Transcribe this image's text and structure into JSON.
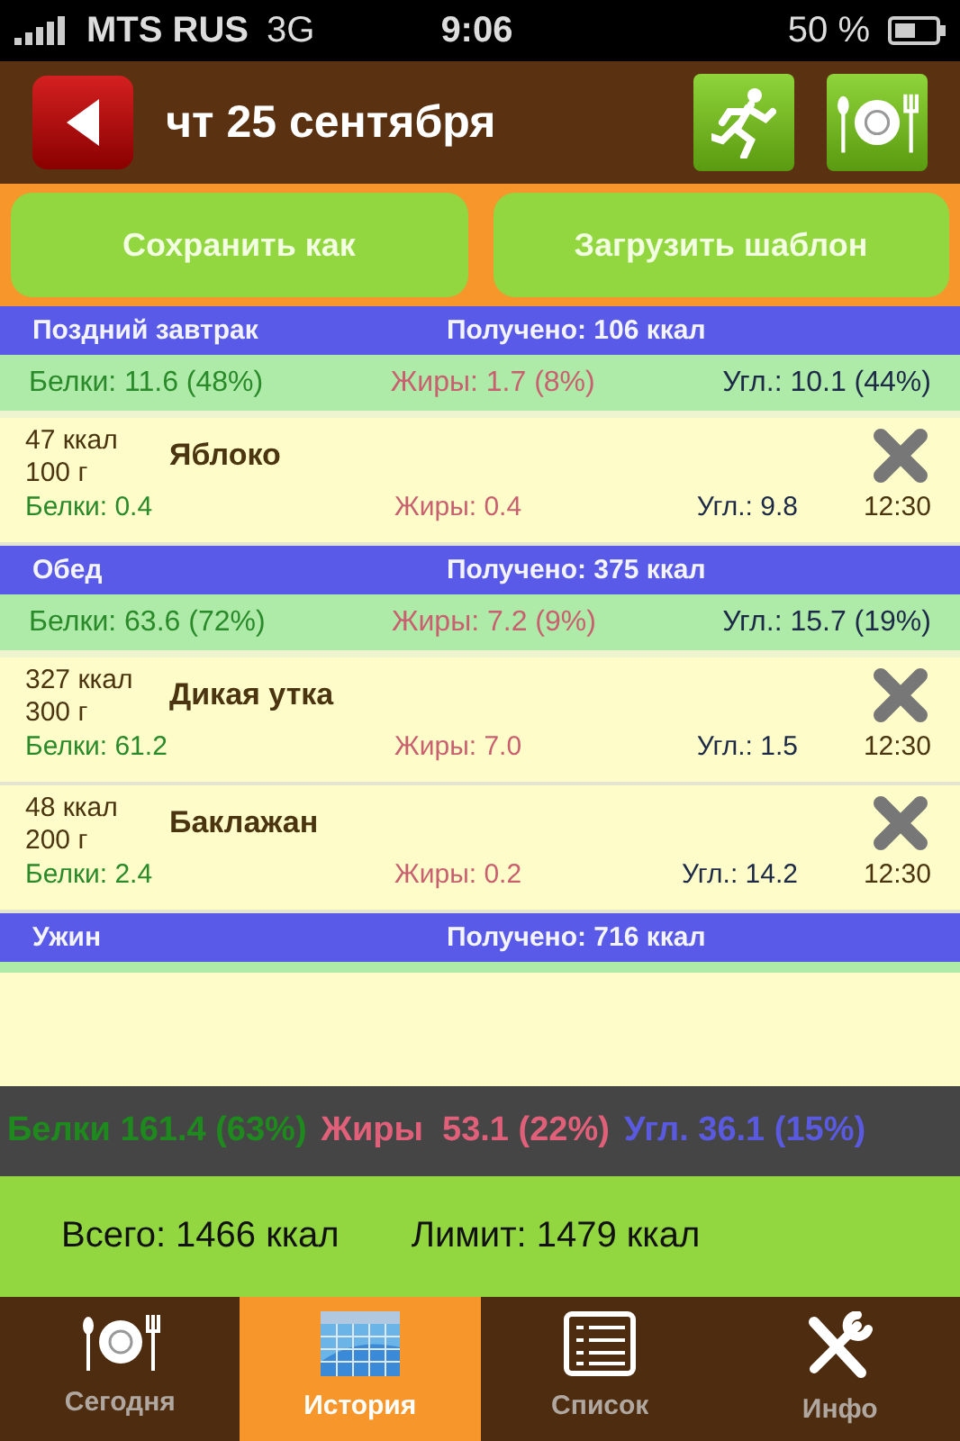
{
  "status_bar": {
    "carrier": "MTS RUS",
    "network": "3G",
    "time": "9:06",
    "battery": "50 %"
  },
  "header": {
    "date": "чт 25 сентября"
  },
  "actions": [
    "Сохранить как",
    "Загрузить шаблон"
  ],
  "meals": [
    {
      "name": "Поздний завтрак",
      "received": "Получено: 106 ккал",
      "macros": {
        "protein": "Белки: 11.6 (48%)",
        "fat": "Жиры: 1.7 (8%)",
        "carbs": "Угл.: 10.1 (44%)"
      },
      "items": [
        {
          "kcal": "47 ккал",
          "weight": "100 г",
          "name": "Яблоко",
          "protein": "Белки: 0.4",
          "fat": "Жиры: 0.4",
          "carbs": "Угл.: 9.8",
          "time": "12:30"
        }
      ]
    },
    {
      "name": "Обед",
      "received": "Получено: 375 ккал",
      "macros": {
        "protein": "Белки: 63.6 (72%)",
        "fat": "Жиры: 7.2 (9%)",
        "carbs": "Угл.: 15.7 (19%)"
      },
      "items": [
        {
          "kcal": "327 ккал",
          "weight": "300 г",
          "name": "Дикая утка",
          "protein": "Белки: 61.2",
          "fat": "Жиры: 7.0",
          "carbs": "Угл.: 1.5",
          "time": "12:30"
        },
        {
          "kcal": "48 ккал",
          "weight": "200 г",
          "name": "Баклажан",
          "protein": "Белки: 2.4",
          "fat": "Жиры: 0.2",
          "carbs": "Угл.: 14.2",
          "time": "12:30"
        }
      ]
    },
    {
      "name": "Ужин",
      "received": "Получено: 716 ккал"
    }
  ],
  "totals": {
    "protein": "Белки 161.4 (63%)",
    "fat": "Жиры  53.1 (22%)",
    "carbs": "Угл. 36.1 (15%)"
  },
  "summary": {
    "total": "Всего: 1466 ккал",
    "limit": "Лимит: 1479 ккал"
  },
  "tabs": [
    {
      "label": "Сегодня",
      "selected": false
    },
    {
      "label": "История",
      "selected": true
    },
    {
      "label": "Список",
      "selected": false
    },
    {
      "label": "Инфо",
      "selected": false
    }
  ]
}
